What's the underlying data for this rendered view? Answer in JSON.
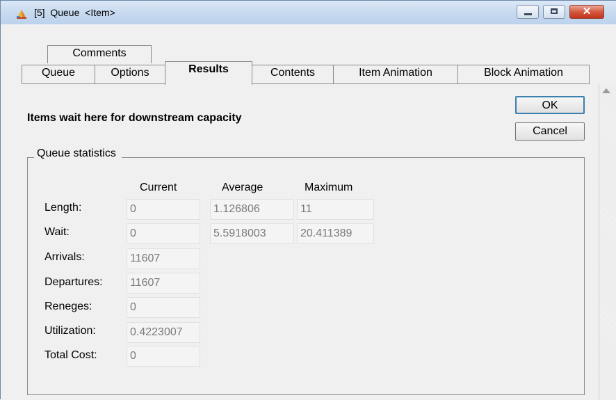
{
  "window": {
    "title": "[5]  Queue  <Item>",
    "controls": {
      "minimize_icon": "minimize-icon",
      "maximize_icon": "maximize-icon",
      "close_glyph": "✕"
    }
  },
  "tabs": {
    "row1": [
      "Comments"
    ],
    "row2": [
      "Queue",
      "Options",
      "Results",
      "Contents",
      "Item Animation",
      "Block Animation"
    ],
    "active": "Results"
  },
  "panel": {
    "heading": "Items wait here for downstream capacity",
    "ok_label": "OK",
    "cancel_label": "Cancel"
  },
  "stats": {
    "group_label": "Queue statistics",
    "columns": [
      "Current",
      "Average",
      "Maximum"
    ],
    "rows": [
      {
        "label": "Length:",
        "current": "0",
        "average": "1.126806",
        "maximum": "11"
      },
      {
        "label": "Wait:",
        "current": "0",
        "average": "5.5918003",
        "maximum": "20.411389"
      },
      {
        "label": "Arrivals:",
        "current": "11607"
      },
      {
        "label": "Departures:",
        "current": "11607"
      },
      {
        "label": "Reneges:",
        "current": "0"
      },
      {
        "label": "Utilization:",
        "current": "0.4223007"
      },
      {
        "label": "Total Cost:",
        "current": "0"
      }
    ]
  }
}
